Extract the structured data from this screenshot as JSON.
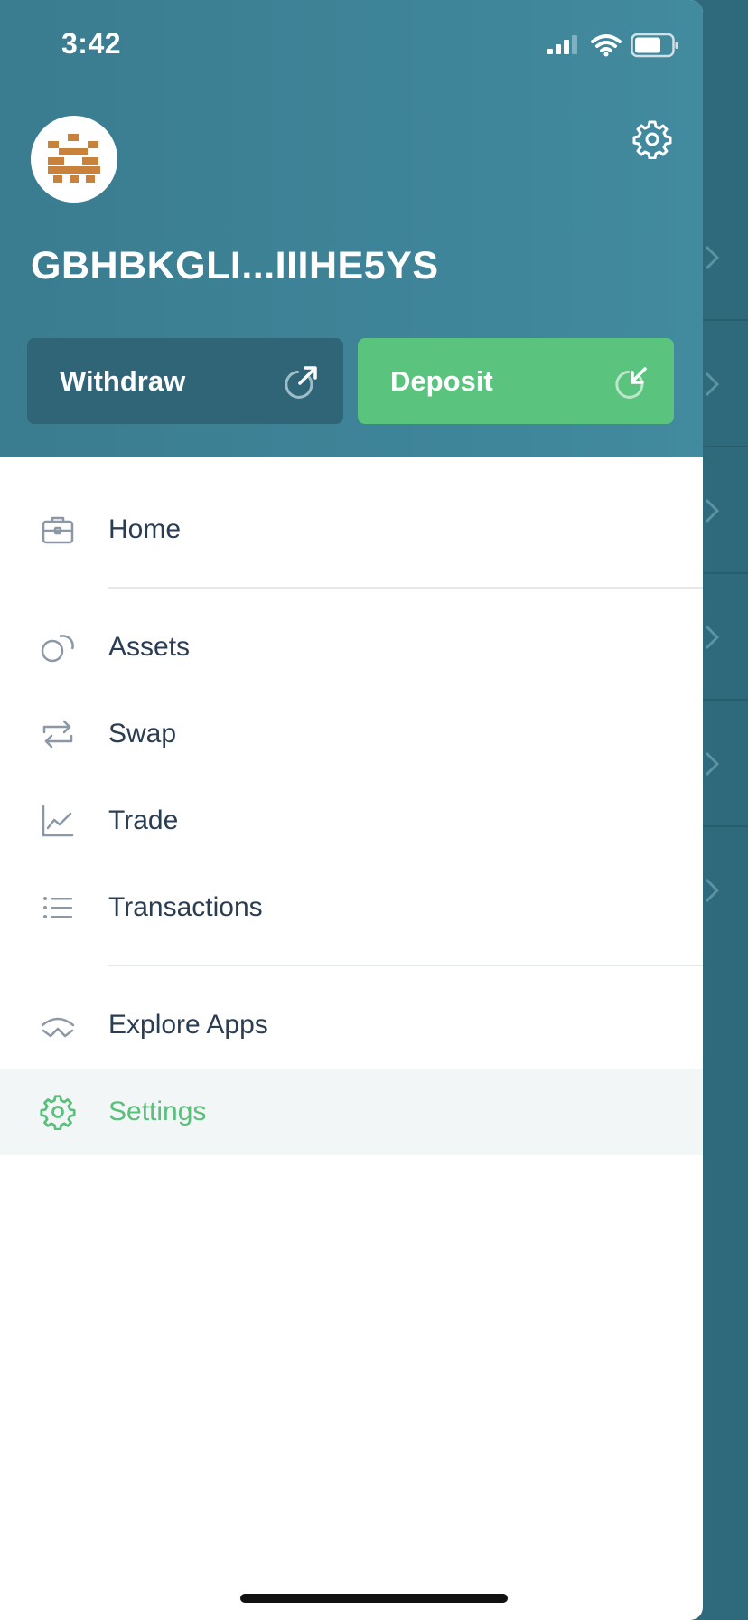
{
  "status_bar": {
    "time": "3:42"
  },
  "header": {
    "account_address": "GBHBKGLI...IIIHE5YS",
    "settings_icon": "gear-icon"
  },
  "actions": {
    "withdraw_label": "Withdraw",
    "withdraw_icon": "arrow-up-right-icon",
    "deposit_label": "Deposit",
    "deposit_icon": "arrow-down-left-icon"
  },
  "menu": {
    "items": [
      {
        "label": "Home",
        "icon": "briefcase-icon"
      },
      {
        "label": "Assets",
        "icon": "coins-icon"
      },
      {
        "label": "Swap",
        "icon": "swap-arrows-icon"
      },
      {
        "label": "Trade",
        "icon": "chart-icon"
      },
      {
        "label": "Transactions",
        "icon": "list-icon"
      },
      {
        "label": "Explore Apps",
        "icon": "explore-icon"
      },
      {
        "label": "Settings",
        "icon": "gear-icon",
        "active": true
      }
    ]
  },
  "colors": {
    "header": "#3f8598",
    "withdraw": "#2f6576",
    "deposit": "#5ac47f",
    "active_text": "#58c07b",
    "menu_text": "#2b3d52"
  }
}
